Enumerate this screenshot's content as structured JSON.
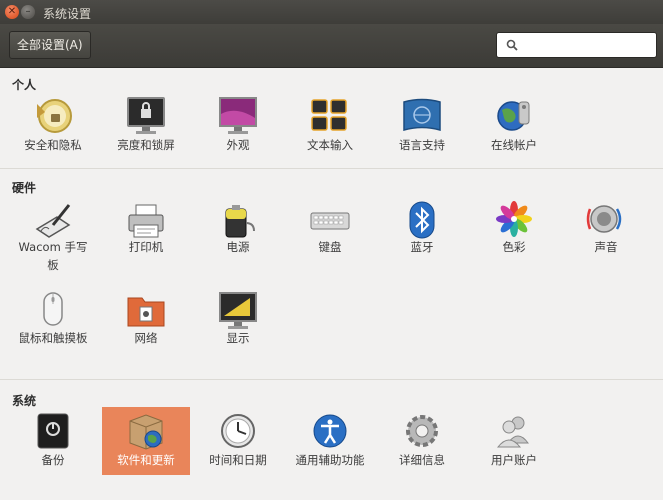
{
  "window": {
    "title": "系统设置"
  },
  "toolbar": {
    "all_settings_label": "全部设置(A)",
    "search_value": "",
    "search_placeholder": ""
  },
  "sections": [
    {
      "title": "个人",
      "items": [
        {
          "label": "安全和隐私",
          "icon": "security-privacy-icon"
        },
        {
          "label": "亮度和锁屏",
          "icon": "brightness-lock-icon"
        },
        {
          "label": "外观",
          "icon": "appearance-icon"
        },
        {
          "label": "文本输入",
          "icon": "text-entry-icon"
        },
        {
          "label": "语言支持",
          "icon": "language-support-icon"
        },
        {
          "label": "在线帐户",
          "icon": "online-accounts-icon"
        }
      ]
    },
    {
      "title": "硬件",
      "items": [
        {
          "label": "Wacom 手写",
          "label2": "板",
          "icon": "wacom-tablet-icon"
        },
        {
          "label": "打印机",
          "icon": "printer-icon"
        },
        {
          "label": "电源",
          "icon": "power-icon"
        },
        {
          "label": "键盘",
          "icon": "keyboard-icon"
        },
        {
          "label": "蓝牙",
          "icon": "bluetooth-icon"
        },
        {
          "label": "色彩",
          "icon": "color-icon"
        },
        {
          "label": "声音",
          "icon": "sound-icon"
        },
        {
          "label": "鼠标和触摸板",
          "icon": "mouse-touchpad-icon"
        },
        {
          "label": "网络",
          "icon": "network-icon"
        },
        {
          "label": "显示",
          "icon": "display-icon"
        }
      ]
    },
    {
      "title": "系统",
      "items": [
        {
          "label": "备份",
          "icon": "backup-icon"
        },
        {
          "label": "软件和更新",
          "icon": "software-updates-icon",
          "selected": true
        },
        {
          "label": "时间和日期",
          "icon": "time-date-icon"
        },
        {
          "label": "通用辅助功能",
          "icon": "universal-access-icon"
        },
        {
          "label": "详细信息",
          "icon": "details-icon"
        },
        {
          "label": "用户账户",
          "icon": "user-accounts-icon"
        }
      ]
    }
  ],
  "colors": {
    "selected_bg": "#e9855a",
    "titlebar": "#3e3d39",
    "close_button": "#e05a2c"
  }
}
